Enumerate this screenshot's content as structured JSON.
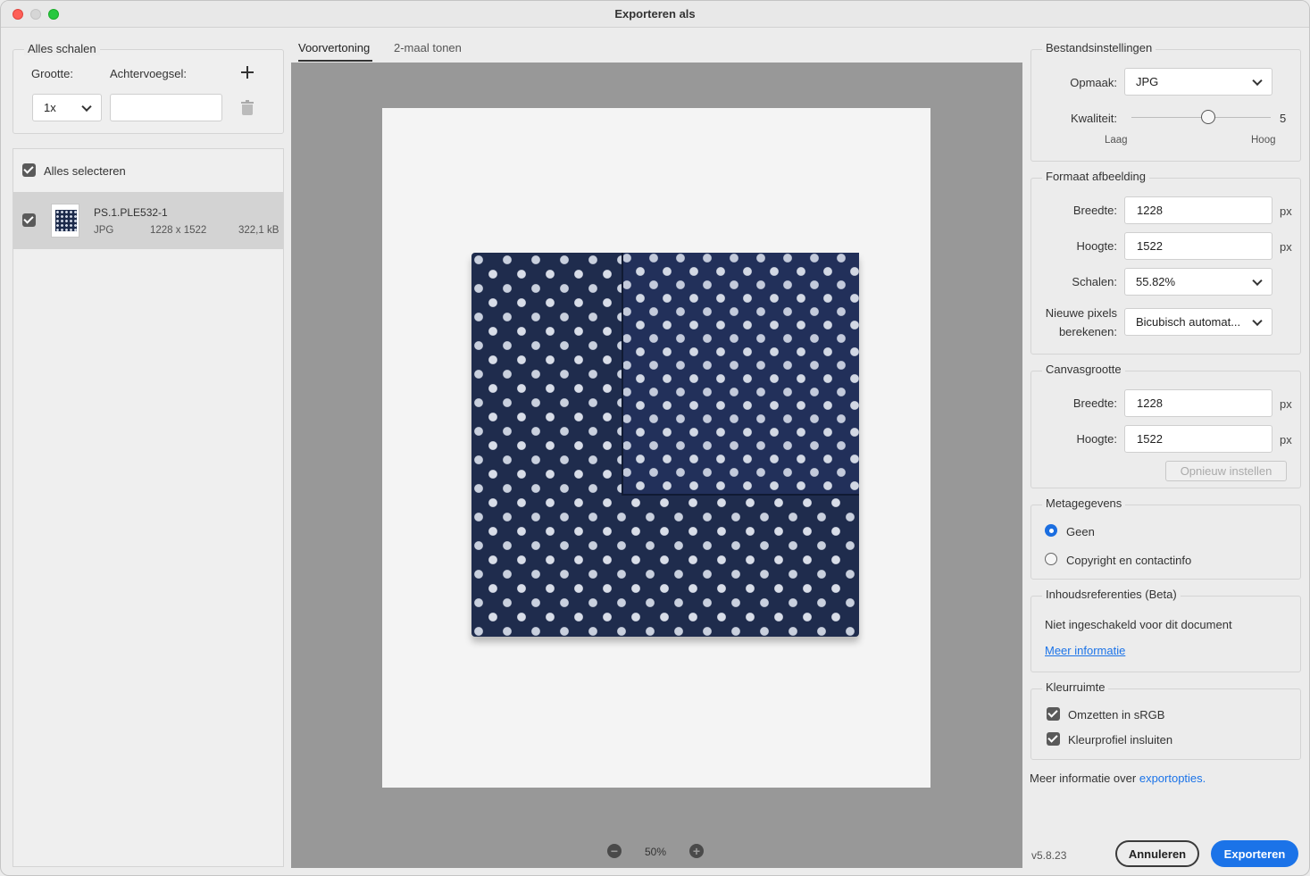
{
  "window": {
    "title": "Exporteren als"
  },
  "scale_group": {
    "legend": "Alles schalen",
    "size_label": "Grootte:",
    "suffix_label": "Achtervoegsel:",
    "size_value": "1x",
    "suffix_value": ""
  },
  "files": {
    "select_all": "Alles selecteren",
    "items": [
      {
        "name": "PS.1.PLE532-1",
        "format": "JPG",
        "dimensions": "1228 x 1522",
        "size": "322,1 kB",
        "checked": true
      }
    ]
  },
  "tabs": [
    {
      "label": "Voorvertoning",
      "active": true
    },
    {
      "label": "2-maal tonen",
      "active": false
    }
  ],
  "preview": {
    "zoom": "50%"
  },
  "file_settings": {
    "legend": "Bestandsinstellingen",
    "format_label": "Opmaak:",
    "format_value": "JPG",
    "quality_label": "Kwaliteit:",
    "quality_value": "5",
    "quality_fraction": 0.55,
    "low": "Laag",
    "high": "Hoog"
  },
  "image_size": {
    "legend": "Formaat afbeelding",
    "width_label": "Breedte:",
    "width_value": "1228",
    "height_label": "Hoogte:",
    "height_value": "1522",
    "scale_label": "Schalen:",
    "scale_value": "55.82%",
    "resample_label_1": "Nieuwe pixels",
    "resample_label_2": "berekenen:",
    "resample_value": "Bicubisch automat...",
    "unit": "px"
  },
  "canvas_size": {
    "legend": "Canvasgrootte",
    "width_label": "Breedte:",
    "width_value": "1228",
    "height_label": "Hoogte:",
    "height_value": "1522",
    "reset": "Opnieuw instellen",
    "unit": "px"
  },
  "metadata": {
    "legend": "Metagegevens",
    "options": [
      {
        "label": "Geen",
        "selected": true
      },
      {
        "label": "Copyright en contactinfo",
        "selected": false
      }
    ]
  },
  "content_credentials": {
    "legend": "Inhoudsreferenties (Beta)",
    "text": "Niet ingeschakeld voor dit document",
    "link": "Meer informatie"
  },
  "color_space": {
    "legend": "Kleurruimte",
    "convert": "Omzetten in sRGB",
    "embed": "Kleurprofiel insluiten"
  },
  "footer": {
    "info_prefix": "Meer informatie over",
    "info_link": "exportopties.",
    "version": "v5.8.23",
    "cancel": "Annuleren",
    "export": "Exporteren"
  },
  "colors": {
    "accent": "#1b73e8",
    "fabric": "#1f2c4d"
  }
}
